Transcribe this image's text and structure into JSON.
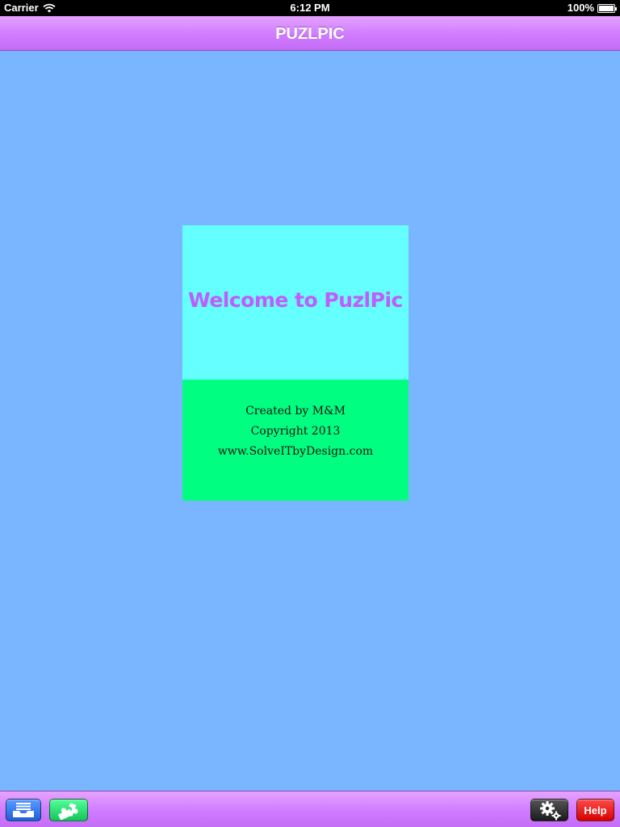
{
  "status_bar": {
    "carrier": "Carrier",
    "time": "6:12 PM",
    "battery": "100%",
    "icons": [
      "wifi-icon",
      "battery-icon"
    ]
  },
  "nav": {
    "title": "PUZLPIC"
  },
  "welcome_card": {
    "heading": "Welcome to PuzlPic",
    "lines": [
      "Created by M&M",
      "Copyright 2013",
      "www.SolveITbyDesign.com"
    ]
  },
  "toolbar": {
    "left_buttons": [
      "inbox-tray-icon",
      "puzzle-piece-icon"
    ],
    "right_buttons": [
      "gears-icon"
    ],
    "help_label": "Help"
  },
  "colors": {
    "background": "#7ab6ff",
    "nav_bar": "#d58aff",
    "card_top": "#66ffff",
    "card_bottom": "#00ff80",
    "welcome_text": "#c05bff",
    "help_button": "#ee1111",
    "inbox_button": "#2f72ee",
    "puzzle_button": "#22dd66",
    "settings_button": "#2a2a2a"
  }
}
